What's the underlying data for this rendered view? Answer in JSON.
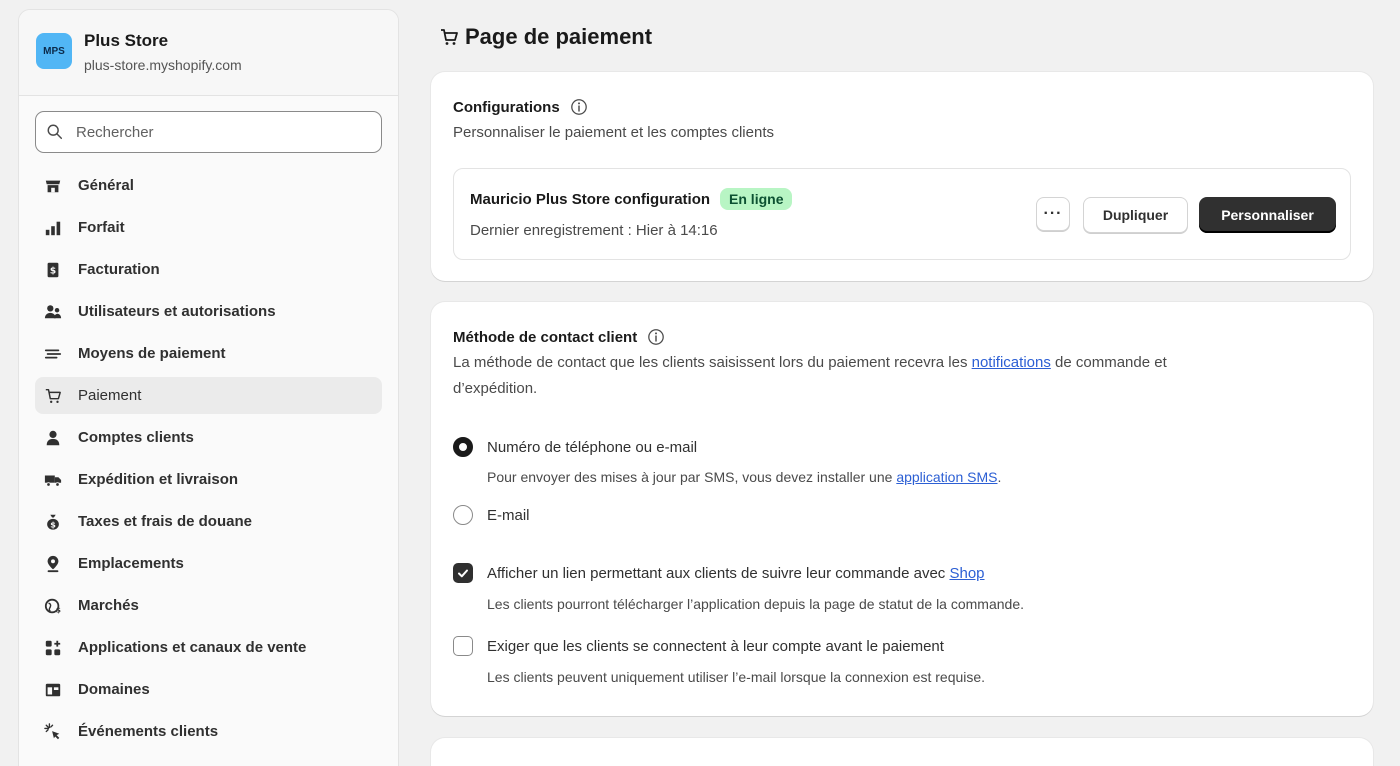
{
  "store": {
    "logo_text": "MPS",
    "name": "Plus Store",
    "domain": "plus-store.myshopify.com"
  },
  "search": {
    "placeholder": "Rechercher"
  },
  "nav": {
    "items": [
      {
        "label": "Général",
        "icon": "store-icon"
      },
      {
        "label": "Forfait",
        "icon": "plan-icon"
      },
      {
        "label": "Facturation",
        "icon": "receipt-icon"
      },
      {
        "label": "Utilisateurs et autorisations",
        "icon": "users-icon"
      },
      {
        "label": "Moyens de paiement",
        "icon": "payments-icon"
      },
      {
        "label": "Paiement",
        "icon": "cart-icon",
        "active": true
      },
      {
        "label": "Comptes clients",
        "icon": "person-icon"
      },
      {
        "label": "Expédition et livraison",
        "icon": "truck-icon"
      },
      {
        "label": "Taxes et frais de douane",
        "icon": "money-bag-icon"
      },
      {
        "label": "Emplacements",
        "icon": "location-icon"
      },
      {
        "label": "Marchés",
        "icon": "globe-icon"
      },
      {
        "label": "Applications et canaux de vente",
        "icon": "apps-icon"
      },
      {
        "label": "Domaines",
        "icon": "domain-icon"
      },
      {
        "label": "Événements clients",
        "icon": "cursor-click-icon"
      }
    ]
  },
  "page": {
    "title": "Page de paiement"
  },
  "config_card": {
    "title": "Configurations",
    "subtitle": "Personnaliser le paiement et les comptes clients",
    "config_name": "Mauricio Plus Store configuration",
    "status_badge": "En ligne",
    "last_saved": "Dernier enregistrement : Hier à 14:16",
    "more_label": "···",
    "duplicate_label": "Dupliquer",
    "customize_label": "Personnaliser"
  },
  "contact_card": {
    "title": "Méthode de contact client",
    "desc_before": "La méthode de contact que les clients saisissent lors du paiement recevra les ",
    "desc_link": "notifications",
    "desc_after": " de commande et",
    "desc_line2": "d’expédition.",
    "option_phone": "Numéro de téléphone ou e-mail",
    "option_phone_help_before": "Pour envoyer des mises à jour par SMS, vous devez installer une ",
    "option_phone_help_link": "application SMS",
    "option_phone_help_after": ".",
    "option_email": "E-mail",
    "shop_link_label": "Afficher un lien permettant aux clients de suivre leur commande avec ",
    "shop_link_text": "Shop",
    "shop_help": "Les clients pourront télécharger l’application depuis la page de statut de la commande.",
    "require_login_label": "Exiger que les clients se connectent à leur compte avant le paiement",
    "require_login_help": "Les clients peuvent uniquement utiliser l’e-mail lorsque la connexion est requise.",
    "selected_option": "phone_or_email",
    "shop_link_checked": true,
    "require_login_checked": false
  }
}
